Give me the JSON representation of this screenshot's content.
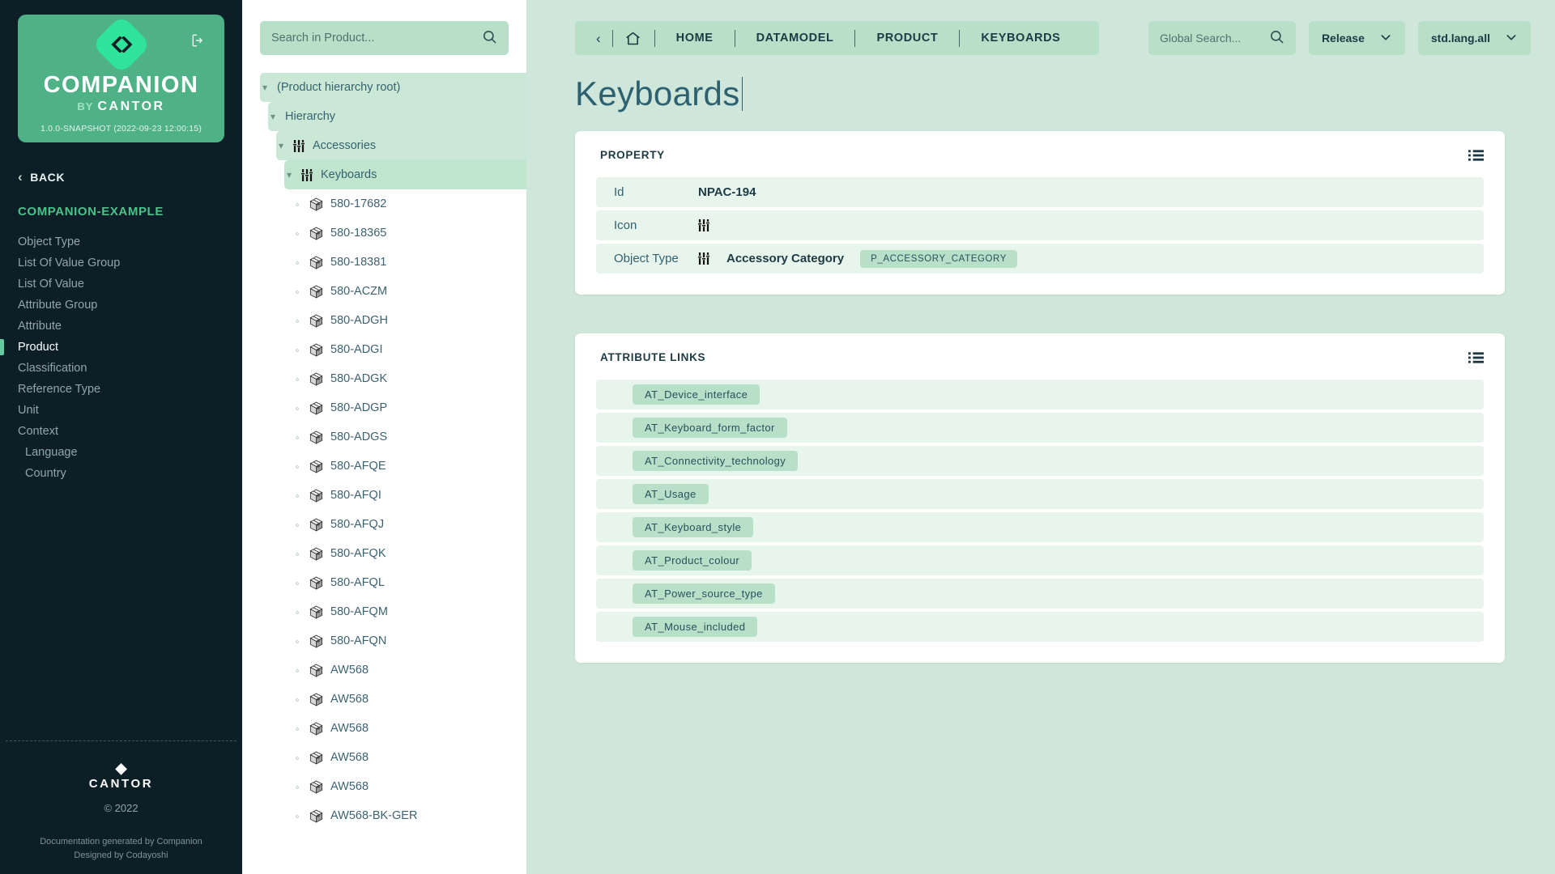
{
  "sidebar": {
    "logo": {
      "icon": "code-brackets-icon",
      "brand": "COMPANION",
      "by": "BY",
      "cantor": "CANTOR",
      "version": "1.0.0-SNAPSHOT  (2022-09-23 12:00:15)",
      "logout_icon": "logout-icon"
    },
    "back_label": "BACK",
    "project_title": "COMPANION-EXAMPLE",
    "items": [
      {
        "label": "Object Type",
        "active": false,
        "sub": false
      },
      {
        "label": "List Of Value Group",
        "active": false,
        "sub": false
      },
      {
        "label": "List Of Value",
        "active": false,
        "sub": false
      },
      {
        "label": "Attribute Group",
        "active": false,
        "sub": false
      },
      {
        "label": "Attribute",
        "active": false,
        "sub": false
      },
      {
        "label": "Product",
        "active": true,
        "sub": false
      },
      {
        "label": "Classification",
        "active": false,
        "sub": false
      },
      {
        "label": "Reference Type",
        "active": false,
        "sub": false
      },
      {
        "label": "Unit",
        "active": false,
        "sub": false
      },
      {
        "label": "Context",
        "active": false,
        "sub": false
      },
      {
        "label": "Language",
        "active": false,
        "sub": true
      },
      {
        "label": "Country",
        "active": false,
        "sub": true
      }
    ],
    "footer": {
      "cantor_mark": "CANTOR",
      "copyright": "© 2022",
      "generated_line1": "Documentation generated by Companion",
      "generated_line2": "Designed by Codayoshi"
    }
  },
  "tree_panel": {
    "search": {
      "placeholder": "Search in Product...",
      "value": "",
      "icon": "search-icon"
    },
    "nodes": [
      {
        "label": "(Product hierarchy root)",
        "type": "branch",
        "depth": 0,
        "icon": null,
        "expanded": true,
        "selected": false
      },
      {
        "label": "Hierarchy",
        "type": "branch",
        "depth": 1,
        "icon": null,
        "expanded": true,
        "selected": false
      },
      {
        "label": "Accessories",
        "type": "branch",
        "depth": 2,
        "icon": "sliders-icon",
        "expanded": true,
        "selected": false
      },
      {
        "label": "Keyboards",
        "type": "branch",
        "depth": 3,
        "icon": "sliders-icon",
        "expanded": true,
        "selected": true
      },
      {
        "label": "580-17682",
        "type": "leaf",
        "depth": 4,
        "icon": "box-icon"
      },
      {
        "label": "580-18365",
        "type": "leaf",
        "depth": 4,
        "icon": "box-icon"
      },
      {
        "label": "580-18381",
        "type": "leaf",
        "depth": 4,
        "icon": "box-icon"
      },
      {
        "label": "580-ACZM",
        "type": "leaf",
        "depth": 4,
        "icon": "box-icon"
      },
      {
        "label": "580-ADGH",
        "type": "leaf",
        "depth": 4,
        "icon": "box-icon"
      },
      {
        "label": "580-ADGI",
        "type": "leaf",
        "depth": 4,
        "icon": "box-icon"
      },
      {
        "label": "580-ADGK",
        "type": "leaf",
        "depth": 4,
        "icon": "box-icon"
      },
      {
        "label": "580-ADGP",
        "type": "leaf",
        "depth": 4,
        "icon": "box-icon"
      },
      {
        "label": "580-ADGS",
        "type": "leaf",
        "depth": 4,
        "icon": "box-icon"
      },
      {
        "label": "580-AFQE",
        "type": "leaf",
        "depth": 4,
        "icon": "box-icon"
      },
      {
        "label": "580-AFQI",
        "type": "leaf",
        "depth": 4,
        "icon": "box-icon"
      },
      {
        "label": "580-AFQJ",
        "type": "leaf",
        "depth": 4,
        "icon": "box-icon"
      },
      {
        "label": "580-AFQK",
        "type": "leaf",
        "depth": 4,
        "icon": "box-icon"
      },
      {
        "label": "580-AFQL",
        "type": "leaf",
        "depth": 4,
        "icon": "box-icon"
      },
      {
        "label": "580-AFQM",
        "type": "leaf",
        "depth": 4,
        "icon": "box-icon"
      },
      {
        "label": "580-AFQN",
        "type": "leaf",
        "depth": 4,
        "icon": "box-icon"
      },
      {
        "label": "AW568",
        "type": "leaf",
        "depth": 4,
        "icon": "box-icon"
      },
      {
        "label": "AW568",
        "type": "leaf",
        "depth": 4,
        "icon": "box-icon"
      },
      {
        "label": "AW568",
        "type": "leaf",
        "depth": 4,
        "icon": "box-icon"
      },
      {
        "label": "AW568",
        "type": "leaf",
        "depth": 4,
        "icon": "box-icon"
      },
      {
        "label": "AW568",
        "type": "leaf",
        "depth": 4,
        "icon": "box-icon"
      },
      {
        "label": "AW568-BK-GER",
        "type": "leaf",
        "depth": 4,
        "icon": "box-icon"
      }
    ]
  },
  "header": {
    "back_icon": "chevron-left-icon",
    "home_icon": "home-icon",
    "breadcrumbs": [
      "HOME",
      "DATAMODEL",
      "PRODUCT",
      "KEYBOARDS"
    ],
    "global_search": {
      "placeholder": "Global Search...",
      "value": "",
      "icon": "search-icon"
    },
    "release_dropdown": {
      "label": "Release",
      "icon": "chevron-down-icon"
    },
    "language_dropdown": {
      "label": "std.lang.all",
      "icon": "chevron-down-icon"
    }
  },
  "main": {
    "page_title": "Keyboards",
    "property_panel": {
      "title": "PROPERTY",
      "menu_icon": "list-menu-icon",
      "rows": [
        {
          "key": "Id",
          "value": "NPAC-194",
          "icon": null,
          "chip": null
        },
        {
          "key": "Icon",
          "value": "",
          "icon": "sliders-icon",
          "chip": null
        },
        {
          "key": "Object Type",
          "value": "Accessory Category",
          "icon": "sliders-icon",
          "chip": "P_ACCESSORY_CATEGORY"
        }
      ]
    },
    "attribute_links_panel": {
      "title": "ATTRIBUTE LINKS",
      "menu_icon": "list-menu-icon",
      "links": [
        "AT_Device_interface",
        "AT_Keyboard_form_factor",
        "AT_Connectivity_technology",
        "AT_Usage",
        "AT_Keyboard_style",
        "AT_Product_colour",
        "AT_Power_source_type",
        "AT_Mouse_included"
      ]
    }
  },
  "colors": {
    "sidebar_bg": "#0c1f26",
    "logo_card": "#4fb186",
    "accent_green": "#2fe39a",
    "main_bg": "#cfe7db",
    "chip_bg": "#b8e0c9",
    "row_bg": "#e7f5ed",
    "text_dark": "#1d3a44"
  }
}
